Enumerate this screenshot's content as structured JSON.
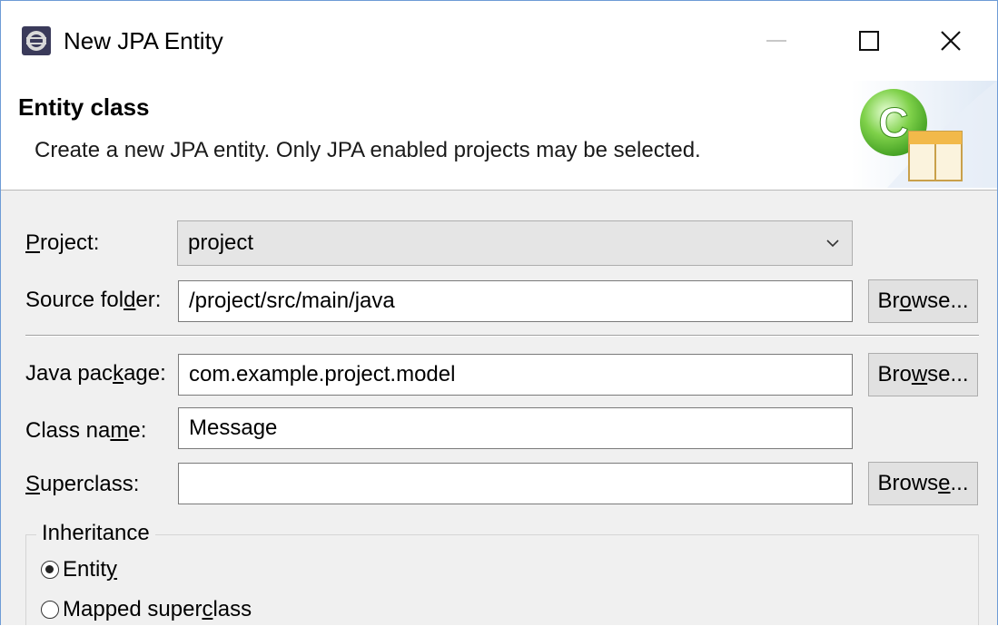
{
  "window": {
    "title": "New JPA Entity"
  },
  "header": {
    "title": "Entity class",
    "description": "Create a new JPA entity. Only JPA enabled projects may be selected."
  },
  "form": {
    "project": {
      "label_pre": "",
      "label_key": "P",
      "label_post": "roject:",
      "value": "project"
    },
    "source_folder": {
      "label_pre": "Source fol",
      "label_key": "d",
      "label_post": "er:",
      "value": "/project/src/main/java",
      "browse": {
        "pre": "Br",
        "key": "o",
        "post": "wse..."
      }
    },
    "java_package": {
      "label_pre": "Java pac",
      "label_key": "k",
      "label_post": "age:",
      "value": "com.example.project.model",
      "browse": {
        "pre": "Bro",
        "key": "w",
        "post": "se..."
      }
    },
    "class_name": {
      "label_pre": "Class na",
      "label_key": "m",
      "label_post": "e:",
      "value": "Message"
    },
    "superclass": {
      "label_pre": "",
      "label_key": "S",
      "label_post": "uperclass:",
      "value": "",
      "browse": {
        "pre": "Brows",
        "key": "e",
        "post": "..."
      }
    }
  },
  "inheritance": {
    "legend": "Inheritance",
    "options": [
      {
        "pre": "Entit",
        "key": "y",
        "post": "",
        "selected": true
      },
      {
        "pre": "Mapped super",
        "key": "c",
        "post": "lass",
        "selected": false
      }
    ]
  },
  "icons": {
    "app": "eclipse-icon",
    "wizard": "jpa-entity-wizard-icon",
    "close": "close-icon",
    "maximize": "maximize-icon",
    "minimize": "minimize-icon",
    "dropdown": "chevron-down-icon"
  }
}
